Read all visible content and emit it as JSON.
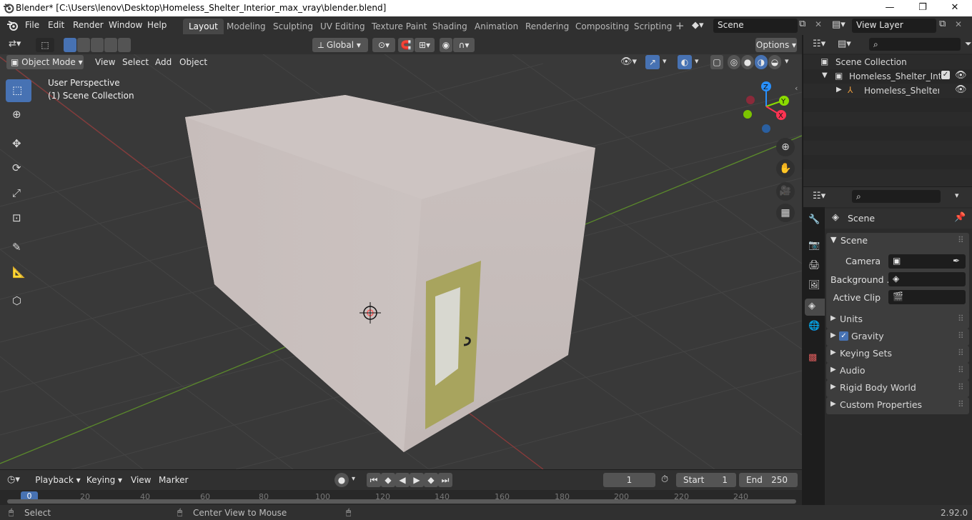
{
  "window": {
    "title": "Blender* [C:\\Users\\lenov\\Desktop\\Homeless_Shelter_Interior_max_vray\\blender.blend]",
    "minimize": "—",
    "maximize": "❐",
    "close": "✕"
  },
  "menu": [
    "File",
    "Edit",
    "Render",
    "Window",
    "Help"
  ],
  "workspaces": [
    "Layout",
    "Modeling",
    "Sculpting",
    "UV Editing",
    "Texture Paint",
    "Shading",
    "Animation",
    "Rendering",
    "Compositing",
    "Scripting"
  ],
  "scene_name": "Scene",
  "view_layer": "View Layer",
  "header": {
    "orientation": "Global",
    "options": "Options",
    "mode": "Object Mode",
    "menus": [
      "View",
      "Select",
      "Add",
      "Object"
    ]
  },
  "viewport": {
    "perspective": "User Perspective",
    "collection": "(1) Scene Collection",
    "gizmo": {
      "z": "Z",
      "y": "Y",
      "x": "X"
    }
  },
  "outliner": {
    "root": "Scene Collection",
    "items": [
      "Homeless_Shelter_Interio",
      "Homeless_Shelter_Ir"
    ]
  },
  "properties": {
    "context": "Scene",
    "panel": "Scene",
    "fields": [
      {
        "label": "Camera"
      },
      {
        "label": "Background ..."
      },
      {
        "label": "Active Clip"
      }
    ],
    "subpanels": [
      "Units",
      "Gravity",
      "Keying Sets",
      "Audio",
      "Rigid Body World",
      "Custom Properties"
    ]
  },
  "timeline": {
    "menus": [
      "Playback",
      "Keying",
      "View",
      "Marker"
    ],
    "current_frame": "1",
    "start_label": "Start",
    "start": "1",
    "end_label": "End",
    "end": "250",
    "ruler": [
      "0",
      "20",
      "40",
      "60",
      "80",
      "100",
      "120",
      "140",
      "160",
      "180",
      "200",
      "220",
      "240"
    ]
  },
  "status": {
    "left": "Select",
    "middle": "Center View to Mouse",
    "version": "2.92.0"
  },
  "colors": {
    "accent": "#4772b3",
    "axis_x": "#ff3352",
    "axis_y": "#8bdc00",
    "axis_z": "#2890ff",
    "grid_red": "#8a3a3a",
    "grid_green": "#5b8a2b",
    "wall": "#c9bfbd",
    "door": "#a8a45e"
  }
}
